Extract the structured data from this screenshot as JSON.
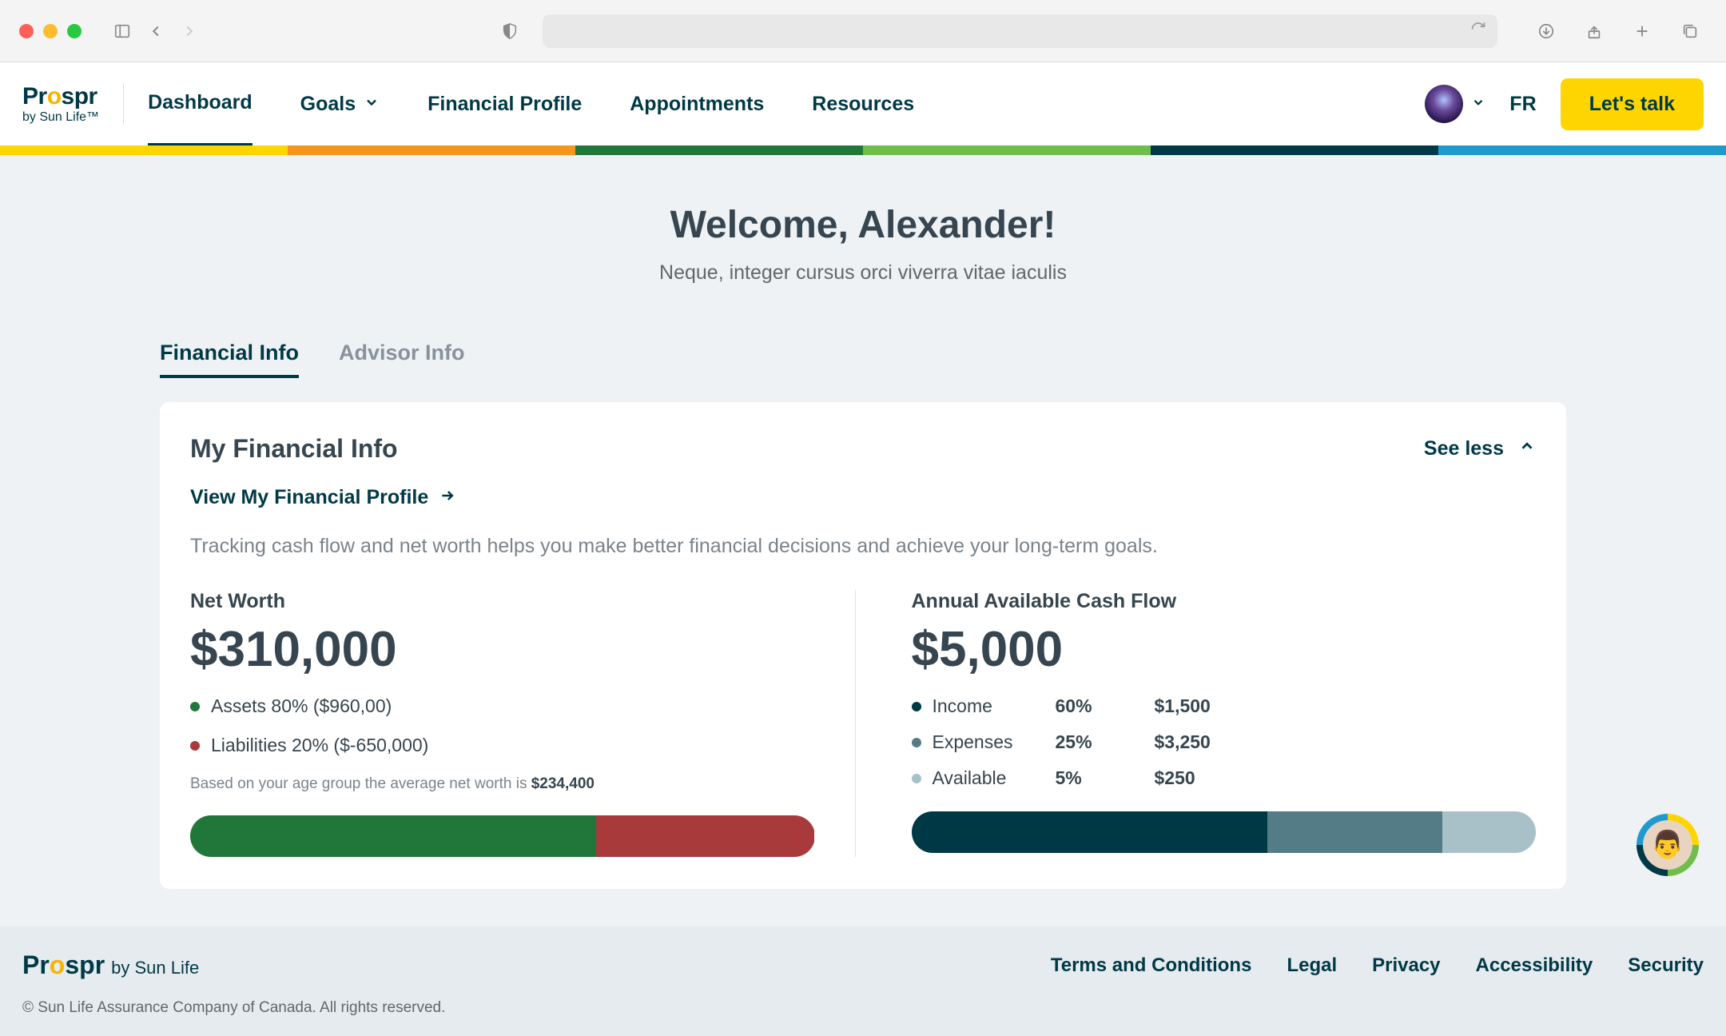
{
  "brand": {
    "name_prefix": "Pr",
    "name_o": "o",
    "name_suffix": "spr",
    "subline": "by Sun Life™",
    "footer_sub": "by Sun Life"
  },
  "nav": {
    "dashboard": "Dashboard",
    "goals": "Goals",
    "financial_profile": "Financial Profile",
    "appointments": "Appointments",
    "resources": "Resources"
  },
  "header": {
    "lang": "FR",
    "cta": "Let's talk"
  },
  "welcome": {
    "title": "Welcome, Alexander!",
    "subtitle": "Neque, integer cursus orci viverra vitae iaculis"
  },
  "tabs": {
    "financial_info": "Financial Info",
    "advisor_info": "Advisor Info"
  },
  "card": {
    "title": "My Financial Info",
    "toggle": "See less",
    "profile_link": "View My Financial Profile",
    "desc": "Tracking cash flow and net worth helps you make better financial decisions and achieve your long-term goals."
  },
  "networth": {
    "label": "Net Worth",
    "value": "$310,000",
    "assets": "Assets 80% ($960,00)",
    "liabilities": "Liabilities 20% ($-650,000)",
    "footnote_text": "Based on your age group the average net worth is ",
    "footnote_value": "$234,400"
  },
  "cashflow": {
    "label": "Annual Available Cash Flow",
    "value": "$5,000",
    "rows": [
      {
        "name": "Income",
        "pct": "60%",
        "amt": "$1,500"
      },
      {
        "name": "Expenses",
        "pct": "25%",
        "amt": "$3,250"
      },
      {
        "name": "Available",
        "pct": "5%",
        "amt": "$250"
      }
    ]
  },
  "footer": {
    "links": {
      "terms": "Terms and Conditions",
      "legal": "Legal",
      "privacy": "Privacy",
      "accessibility": "Accessibility",
      "security": "Security"
    },
    "copyright": "© Sun Life Assurance Company of Canada. All rights reserved."
  },
  "chart_data": [
    {
      "type": "bar",
      "title": "Net Worth breakdown",
      "categories": [
        "Assets",
        "Liabilities"
      ],
      "values": [
        80,
        20
      ],
      "amounts": [
        "$960,00",
        "$-650,000"
      ],
      "colors": [
        "#21773a",
        "#a83a3c"
      ]
    },
    {
      "type": "bar",
      "title": "Annual Available Cash Flow breakdown",
      "categories": [
        "Income",
        "Expenses",
        "Available"
      ],
      "values": [
        60,
        25,
        5
      ],
      "amounts": [
        "$1,500",
        "$3,250",
        "$250"
      ],
      "colors": [
        "#003946",
        "#547c86",
        "#a8c0c8"
      ]
    }
  ]
}
